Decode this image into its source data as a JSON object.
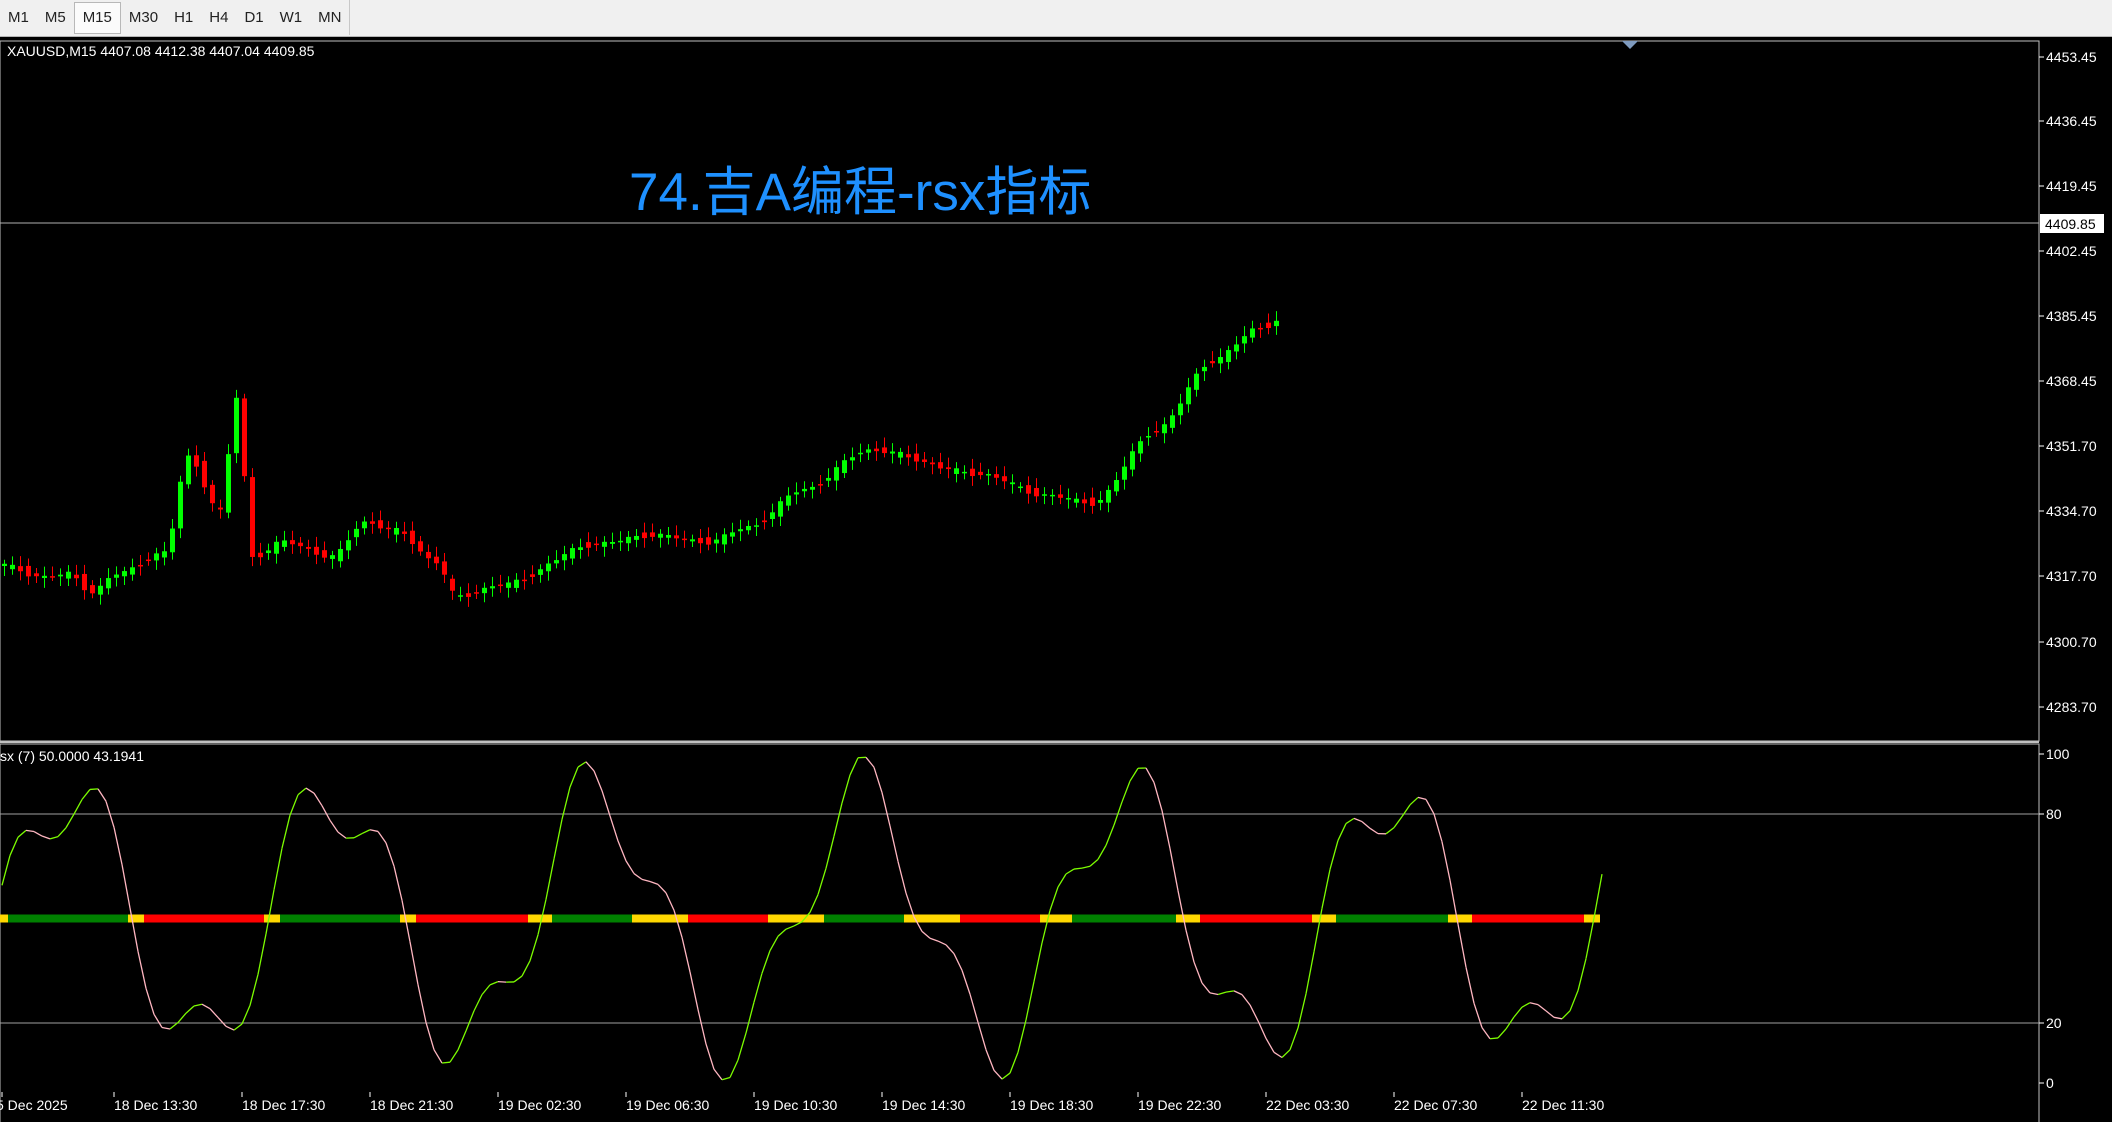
{
  "toolbar": {
    "timeframes": [
      "M1",
      "M5",
      "M15",
      "M30",
      "H1",
      "H4",
      "D1",
      "W1",
      "MN"
    ],
    "active": "M15"
  },
  "main": {
    "symbol_info": "XAUUSD,M15  4407.08 4412.38 4407.04 4409.85",
    "watermark": "74.吉A编程-rsx指标",
    "current_price_label": "4409.85",
    "price_ticks": [
      "4453.45",
      "4436.45",
      "4419.45",
      "4402.45",
      "4385.45",
      "4368.45",
      "4351.70",
      "4334.70",
      "4317.70",
      "4300.70",
      "4283.70"
    ]
  },
  "indicator": {
    "label": "sx (7) 50.0000 43.1941",
    "ticks": [
      "100",
      "80",
      "20",
      "0"
    ],
    "rsx_latest": 43.1941,
    "level": 50
  },
  "time_axis": {
    "labels": [
      "5 Dec 2025",
      "18 Dec 13:30",
      "18 Dec 17:30",
      "18 Dec 21:30",
      "19 Dec 02:30",
      "19 Dec 06:30",
      "19 Dec 10:30",
      "19 Dec 14:30",
      "19 Dec 18:30",
      "19 Dec 22:30",
      "22 Dec 03:30",
      "22 Dec 07:30",
      "22 Dec 11:30"
    ]
  },
  "colors": {
    "background": "#000000",
    "bull": "#00ff00",
    "bear": "#ff0000",
    "rsx_up": "#7cfc00",
    "rsx_down": "#ffb6c1",
    "level_neutral": "#ffd700",
    "level_bull": "#008000",
    "level_bear": "#ff0000",
    "watermark": "#1e90ff",
    "grid": "#a0a0a0"
  }
}
